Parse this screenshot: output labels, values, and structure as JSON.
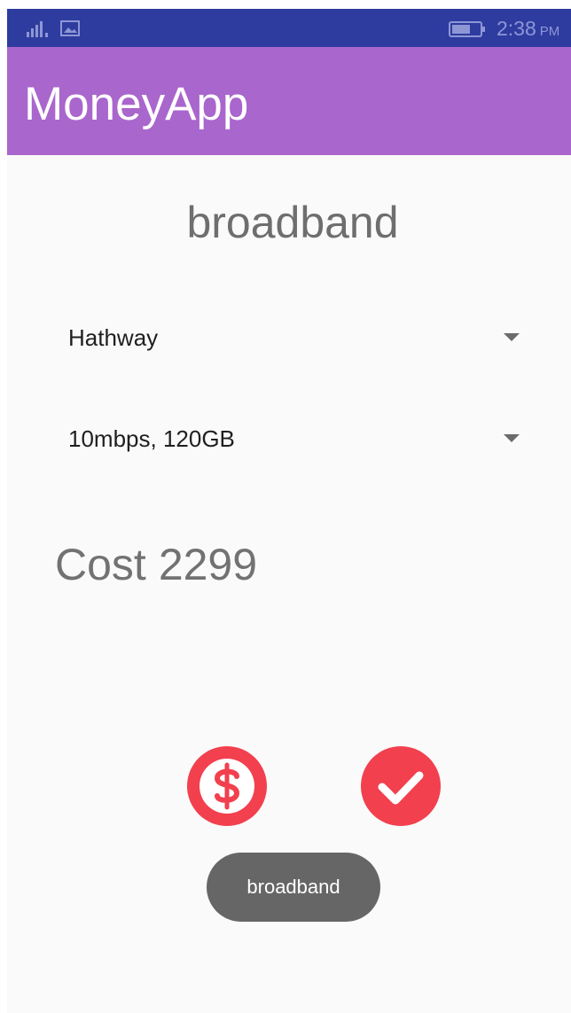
{
  "status_bar": {
    "time": "2:38",
    "ampm": "PM",
    "icons": [
      "signal-icon",
      "image-icon",
      "battery-icon"
    ],
    "color": "#2e3c9f"
  },
  "app_bar": {
    "title": "MoneyApp",
    "color": "#a966cc"
  },
  "main": {
    "category": "broadband",
    "provider_spinner": {
      "selected": "Hathway"
    },
    "plan_spinner": {
      "selected": "10mbps, 120GB"
    },
    "cost_label": "Cost",
    "cost_value": "2299"
  },
  "actions": {
    "pay_icon": "dollar-icon",
    "confirm_icon": "check-icon",
    "color": "#f2404f"
  },
  "toast": {
    "text": "broadband"
  }
}
